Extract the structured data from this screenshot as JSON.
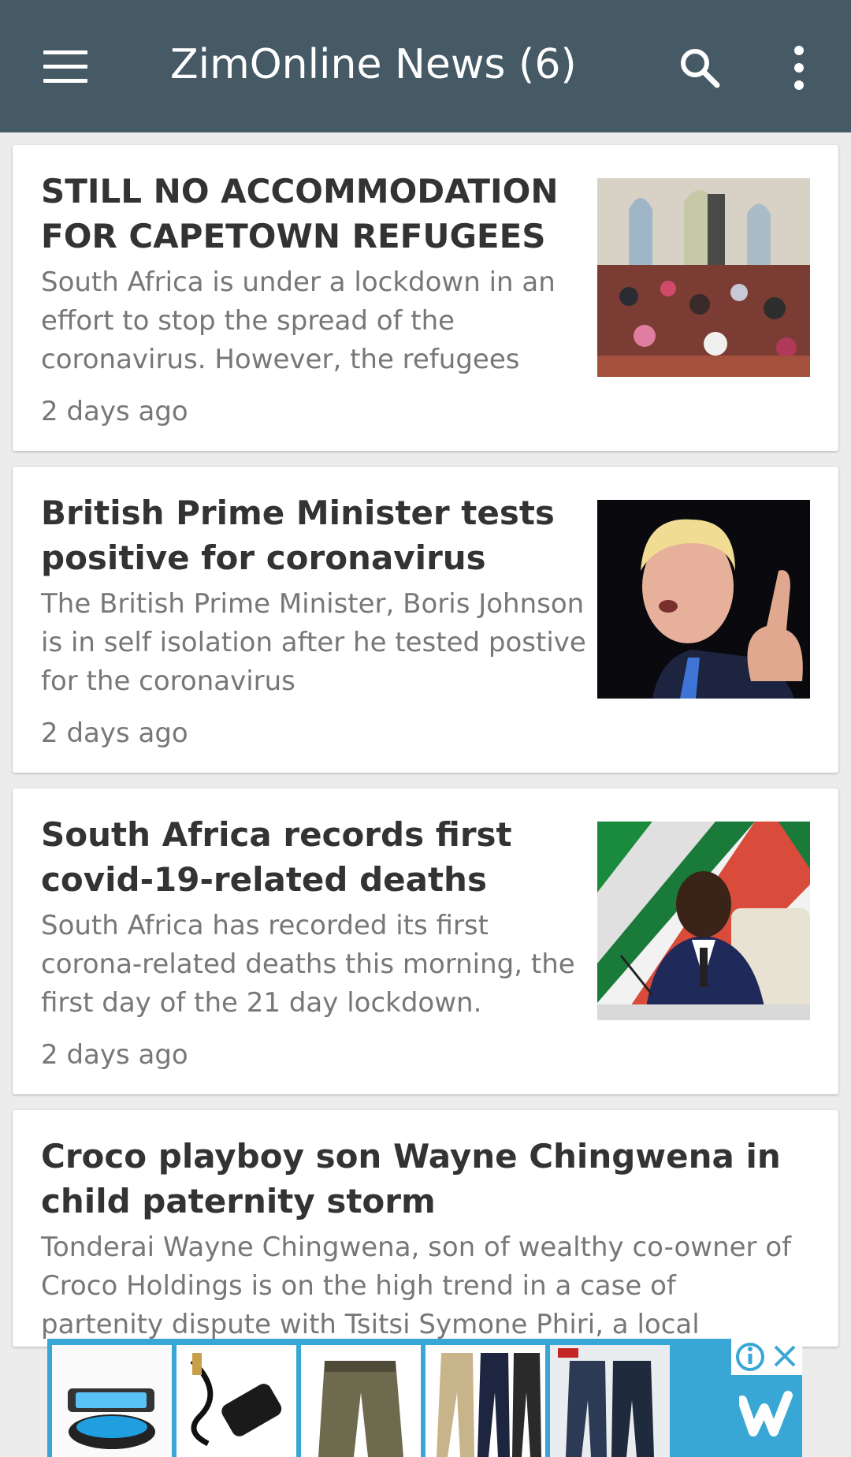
{
  "appbar": {
    "title": "ZimOnline News (6)",
    "icons": [
      "menu-icon",
      "search-icon",
      "more-vert-icon"
    ]
  },
  "articles": [
    {
      "title": "STILL NO ACCOMMODATION FOR CAPETOWN REFUGEES",
      "excerpt": "South Africa is under a lockdown in an effort to stop the spread of the coronavirus. However, the refugees",
      "time": "2 days ago"
    },
    {
      "title": "British Prime Minister tests positive for coronavirus",
      "excerpt": "The British Prime Minister, Boris Johnson is in self isolation after he tested postive for the coronavirus",
      "time": "2 days ago"
    },
    {
      "title": "South Africa records first covid-19-related deaths",
      "excerpt": "South Africa has recorded its first corona-related deaths this morning, the first day of the 21 day lockdown.",
      "time": "2 days ago"
    },
    {
      "title": "Croco playboy son Wayne Chingwena in child paternity storm",
      "excerpt": "Tonderai Wayne Chingwena, son of wealthy co-owner of Croco Holdings is on the high trend in a case of partenity dispute with Tsitsi Symone Phiri, a local"
    }
  ],
  "ad": {
    "colors": {
      "background": "#39a7d6"
    },
    "icons": [
      "ad-info-icon",
      "ad-close-icon",
      "wish-logo-icon"
    ]
  }
}
